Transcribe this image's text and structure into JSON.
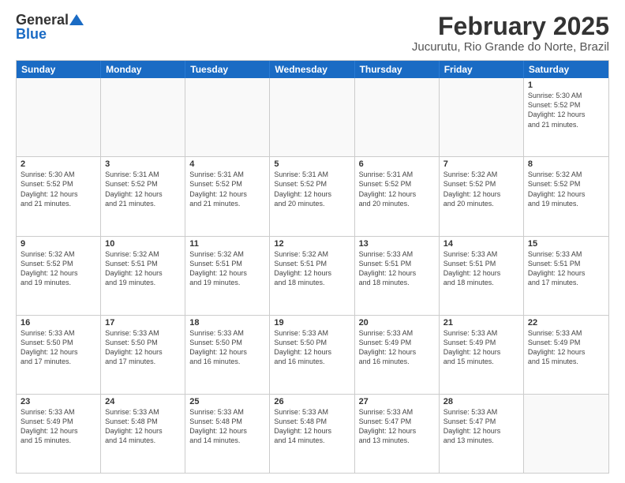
{
  "logo": {
    "general": "General",
    "blue": "Blue"
  },
  "title": "February 2025",
  "subtitle": "Jucurutu, Rio Grande do Norte, Brazil",
  "header_days": [
    "Sunday",
    "Monday",
    "Tuesday",
    "Wednesday",
    "Thursday",
    "Friday",
    "Saturday"
  ],
  "weeks": [
    [
      {
        "day": "",
        "info": ""
      },
      {
        "day": "",
        "info": ""
      },
      {
        "day": "",
        "info": ""
      },
      {
        "day": "",
        "info": ""
      },
      {
        "day": "",
        "info": ""
      },
      {
        "day": "",
        "info": ""
      },
      {
        "day": "1",
        "info": "Sunrise: 5:30 AM\nSunset: 5:52 PM\nDaylight: 12 hours\nand 21 minutes."
      }
    ],
    [
      {
        "day": "2",
        "info": "Sunrise: 5:30 AM\nSunset: 5:52 PM\nDaylight: 12 hours\nand 21 minutes."
      },
      {
        "day": "3",
        "info": "Sunrise: 5:31 AM\nSunset: 5:52 PM\nDaylight: 12 hours\nand 21 minutes."
      },
      {
        "day": "4",
        "info": "Sunrise: 5:31 AM\nSunset: 5:52 PM\nDaylight: 12 hours\nand 21 minutes."
      },
      {
        "day": "5",
        "info": "Sunrise: 5:31 AM\nSunset: 5:52 PM\nDaylight: 12 hours\nand 20 minutes."
      },
      {
        "day": "6",
        "info": "Sunrise: 5:31 AM\nSunset: 5:52 PM\nDaylight: 12 hours\nand 20 minutes."
      },
      {
        "day": "7",
        "info": "Sunrise: 5:32 AM\nSunset: 5:52 PM\nDaylight: 12 hours\nand 20 minutes."
      },
      {
        "day": "8",
        "info": "Sunrise: 5:32 AM\nSunset: 5:52 PM\nDaylight: 12 hours\nand 19 minutes."
      }
    ],
    [
      {
        "day": "9",
        "info": "Sunrise: 5:32 AM\nSunset: 5:52 PM\nDaylight: 12 hours\nand 19 minutes."
      },
      {
        "day": "10",
        "info": "Sunrise: 5:32 AM\nSunset: 5:51 PM\nDaylight: 12 hours\nand 19 minutes."
      },
      {
        "day": "11",
        "info": "Sunrise: 5:32 AM\nSunset: 5:51 PM\nDaylight: 12 hours\nand 19 minutes."
      },
      {
        "day": "12",
        "info": "Sunrise: 5:32 AM\nSunset: 5:51 PM\nDaylight: 12 hours\nand 18 minutes."
      },
      {
        "day": "13",
        "info": "Sunrise: 5:33 AM\nSunset: 5:51 PM\nDaylight: 12 hours\nand 18 minutes."
      },
      {
        "day": "14",
        "info": "Sunrise: 5:33 AM\nSunset: 5:51 PM\nDaylight: 12 hours\nand 18 minutes."
      },
      {
        "day": "15",
        "info": "Sunrise: 5:33 AM\nSunset: 5:51 PM\nDaylight: 12 hours\nand 17 minutes."
      }
    ],
    [
      {
        "day": "16",
        "info": "Sunrise: 5:33 AM\nSunset: 5:50 PM\nDaylight: 12 hours\nand 17 minutes."
      },
      {
        "day": "17",
        "info": "Sunrise: 5:33 AM\nSunset: 5:50 PM\nDaylight: 12 hours\nand 17 minutes."
      },
      {
        "day": "18",
        "info": "Sunrise: 5:33 AM\nSunset: 5:50 PM\nDaylight: 12 hours\nand 16 minutes."
      },
      {
        "day": "19",
        "info": "Sunrise: 5:33 AM\nSunset: 5:50 PM\nDaylight: 12 hours\nand 16 minutes."
      },
      {
        "day": "20",
        "info": "Sunrise: 5:33 AM\nSunset: 5:49 PM\nDaylight: 12 hours\nand 16 minutes."
      },
      {
        "day": "21",
        "info": "Sunrise: 5:33 AM\nSunset: 5:49 PM\nDaylight: 12 hours\nand 15 minutes."
      },
      {
        "day": "22",
        "info": "Sunrise: 5:33 AM\nSunset: 5:49 PM\nDaylight: 12 hours\nand 15 minutes."
      }
    ],
    [
      {
        "day": "23",
        "info": "Sunrise: 5:33 AM\nSunset: 5:49 PM\nDaylight: 12 hours\nand 15 minutes."
      },
      {
        "day": "24",
        "info": "Sunrise: 5:33 AM\nSunset: 5:48 PM\nDaylight: 12 hours\nand 14 minutes."
      },
      {
        "day": "25",
        "info": "Sunrise: 5:33 AM\nSunset: 5:48 PM\nDaylight: 12 hours\nand 14 minutes."
      },
      {
        "day": "26",
        "info": "Sunrise: 5:33 AM\nSunset: 5:48 PM\nDaylight: 12 hours\nand 14 minutes."
      },
      {
        "day": "27",
        "info": "Sunrise: 5:33 AM\nSunset: 5:47 PM\nDaylight: 12 hours\nand 13 minutes."
      },
      {
        "day": "28",
        "info": "Sunrise: 5:33 AM\nSunset: 5:47 PM\nDaylight: 12 hours\nand 13 minutes."
      },
      {
        "day": "",
        "info": ""
      }
    ]
  ]
}
